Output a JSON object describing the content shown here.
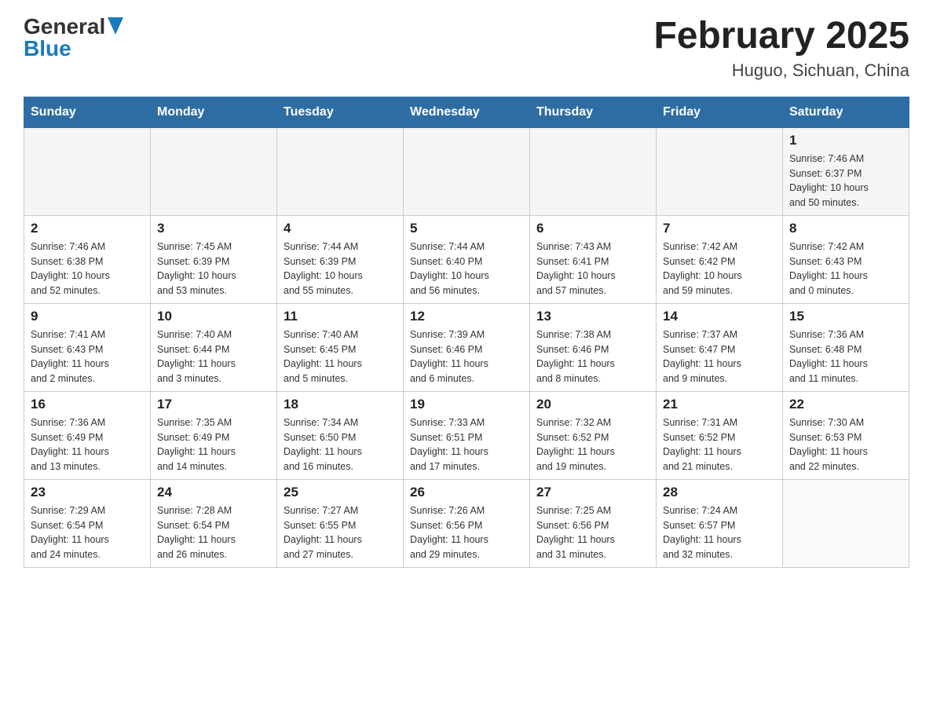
{
  "header": {
    "logo_general": "General",
    "logo_blue": "Blue",
    "title": "February 2025",
    "location": "Huguo, Sichuan, China"
  },
  "days_of_week": [
    "Sunday",
    "Monday",
    "Tuesday",
    "Wednesday",
    "Thursday",
    "Friday",
    "Saturday"
  ],
  "weeks": [
    [
      {
        "day": "",
        "info": ""
      },
      {
        "day": "",
        "info": ""
      },
      {
        "day": "",
        "info": ""
      },
      {
        "day": "",
        "info": ""
      },
      {
        "day": "",
        "info": ""
      },
      {
        "day": "",
        "info": ""
      },
      {
        "day": "1",
        "info": "Sunrise: 7:46 AM\nSunset: 6:37 PM\nDaylight: 10 hours\nand 50 minutes."
      }
    ],
    [
      {
        "day": "2",
        "info": "Sunrise: 7:46 AM\nSunset: 6:38 PM\nDaylight: 10 hours\nand 52 minutes."
      },
      {
        "day": "3",
        "info": "Sunrise: 7:45 AM\nSunset: 6:39 PM\nDaylight: 10 hours\nand 53 minutes."
      },
      {
        "day": "4",
        "info": "Sunrise: 7:44 AM\nSunset: 6:39 PM\nDaylight: 10 hours\nand 55 minutes."
      },
      {
        "day": "5",
        "info": "Sunrise: 7:44 AM\nSunset: 6:40 PM\nDaylight: 10 hours\nand 56 minutes."
      },
      {
        "day": "6",
        "info": "Sunrise: 7:43 AM\nSunset: 6:41 PM\nDaylight: 10 hours\nand 57 minutes."
      },
      {
        "day": "7",
        "info": "Sunrise: 7:42 AM\nSunset: 6:42 PM\nDaylight: 10 hours\nand 59 minutes."
      },
      {
        "day": "8",
        "info": "Sunrise: 7:42 AM\nSunset: 6:43 PM\nDaylight: 11 hours\nand 0 minutes."
      }
    ],
    [
      {
        "day": "9",
        "info": "Sunrise: 7:41 AM\nSunset: 6:43 PM\nDaylight: 11 hours\nand 2 minutes."
      },
      {
        "day": "10",
        "info": "Sunrise: 7:40 AM\nSunset: 6:44 PM\nDaylight: 11 hours\nand 3 minutes."
      },
      {
        "day": "11",
        "info": "Sunrise: 7:40 AM\nSunset: 6:45 PM\nDaylight: 11 hours\nand 5 minutes."
      },
      {
        "day": "12",
        "info": "Sunrise: 7:39 AM\nSunset: 6:46 PM\nDaylight: 11 hours\nand 6 minutes."
      },
      {
        "day": "13",
        "info": "Sunrise: 7:38 AM\nSunset: 6:46 PM\nDaylight: 11 hours\nand 8 minutes."
      },
      {
        "day": "14",
        "info": "Sunrise: 7:37 AM\nSunset: 6:47 PM\nDaylight: 11 hours\nand 9 minutes."
      },
      {
        "day": "15",
        "info": "Sunrise: 7:36 AM\nSunset: 6:48 PM\nDaylight: 11 hours\nand 11 minutes."
      }
    ],
    [
      {
        "day": "16",
        "info": "Sunrise: 7:36 AM\nSunset: 6:49 PM\nDaylight: 11 hours\nand 13 minutes."
      },
      {
        "day": "17",
        "info": "Sunrise: 7:35 AM\nSunset: 6:49 PM\nDaylight: 11 hours\nand 14 minutes."
      },
      {
        "day": "18",
        "info": "Sunrise: 7:34 AM\nSunset: 6:50 PM\nDaylight: 11 hours\nand 16 minutes."
      },
      {
        "day": "19",
        "info": "Sunrise: 7:33 AM\nSunset: 6:51 PM\nDaylight: 11 hours\nand 17 minutes."
      },
      {
        "day": "20",
        "info": "Sunrise: 7:32 AM\nSunset: 6:52 PM\nDaylight: 11 hours\nand 19 minutes."
      },
      {
        "day": "21",
        "info": "Sunrise: 7:31 AM\nSunset: 6:52 PM\nDaylight: 11 hours\nand 21 minutes."
      },
      {
        "day": "22",
        "info": "Sunrise: 7:30 AM\nSunset: 6:53 PM\nDaylight: 11 hours\nand 22 minutes."
      }
    ],
    [
      {
        "day": "23",
        "info": "Sunrise: 7:29 AM\nSunset: 6:54 PM\nDaylight: 11 hours\nand 24 minutes."
      },
      {
        "day": "24",
        "info": "Sunrise: 7:28 AM\nSunset: 6:54 PM\nDaylight: 11 hours\nand 26 minutes."
      },
      {
        "day": "25",
        "info": "Sunrise: 7:27 AM\nSunset: 6:55 PM\nDaylight: 11 hours\nand 27 minutes."
      },
      {
        "day": "26",
        "info": "Sunrise: 7:26 AM\nSunset: 6:56 PM\nDaylight: 11 hours\nand 29 minutes."
      },
      {
        "day": "27",
        "info": "Sunrise: 7:25 AM\nSunset: 6:56 PM\nDaylight: 11 hours\nand 31 minutes."
      },
      {
        "day": "28",
        "info": "Sunrise: 7:24 AM\nSunset: 6:57 PM\nDaylight: 11 hours\nand 32 minutes."
      },
      {
        "day": "",
        "info": ""
      }
    ]
  ]
}
